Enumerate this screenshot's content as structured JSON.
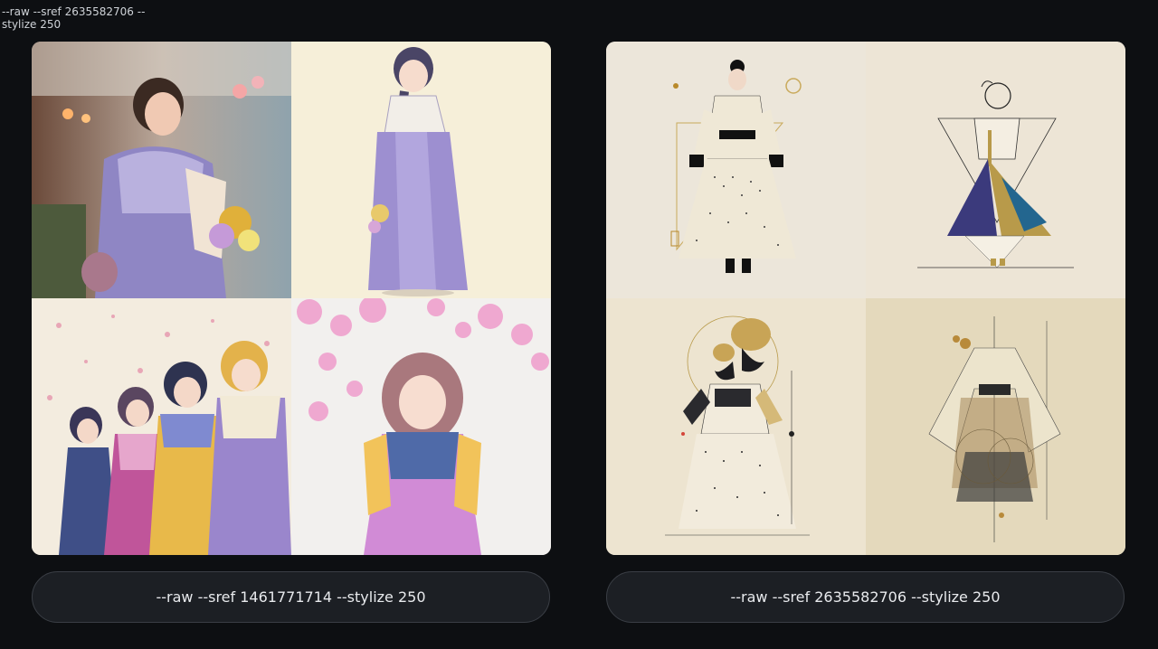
{
  "header": {
    "text": "--raw --sref 2635582706 --stylize 250"
  },
  "cards": [
    {
      "caption": "--raw --sref 1461771714 --stylize 250",
      "images": [
        {
          "name": "photo-girl-hanbok-flowers"
        },
        {
          "name": "illustration-girl-purple-hanbok"
        },
        {
          "name": "illustration-four-girls-hanbok"
        },
        {
          "name": "illustration-girl-cherry-blossoms"
        }
      ]
    },
    {
      "caption": "--raw --sref 2635582706 --stylize 250",
      "images": [
        {
          "name": "fashion-model-dotted-hanbok"
        },
        {
          "name": "geometric-hanbok-illustration"
        },
        {
          "name": "floral-dotted-hanbok-illustration"
        },
        {
          "name": "sheer-hanbok-dress-illustration"
        }
      ]
    }
  ]
}
